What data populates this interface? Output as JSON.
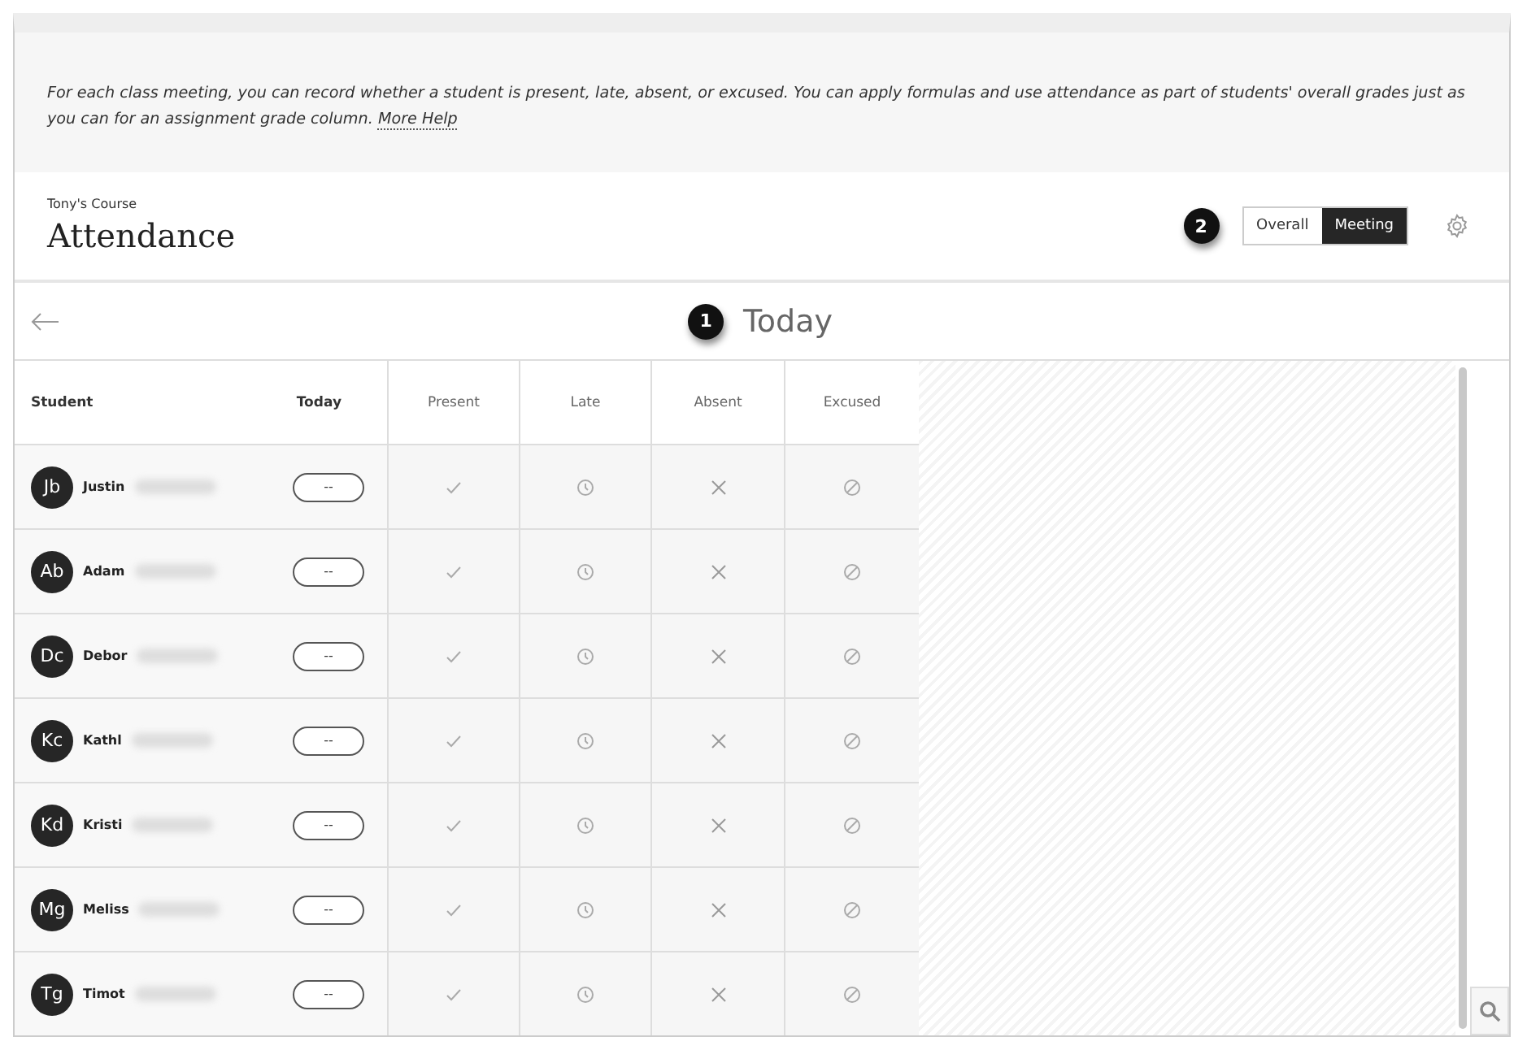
{
  "banner": {
    "text": "For each class meeting, you can record whether a student is present, late, absent, or excused. You can apply formulas and use attendance as part of students' overall grades just as you can for an assignment grade column.",
    "link": "More Help"
  },
  "header": {
    "course": "Tony's Course",
    "title": "Attendance",
    "callout": "2",
    "view_toggle": [
      {
        "label": "Overall",
        "selected": false
      },
      {
        "label": "Meeting",
        "selected": true
      }
    ]
  },
  "date_bar": {
    "callout": "1",
    "title": "Today"
  },
  "table": {
    "columns": [
      "Student",
      "Today",
      "Present",
      "Late",
      "Absent",
      "Excused"
    ],
    "rows": [
      {
        "initials": "Jb",
        "name": "Justin",
        "grade": "--"
      },
      {
        "initials": "Ab",
        "name": "Adam",
        "grade": "--"
      },
      {
        "initials": "Dc",
        "name": "Debor",
        "grade": "--"
      },
      {
        "initials": "Kc",
        "name": "Kathl",
        "grade": "--"
      },
      {
        "initials": "Kd",
        "name": "Kristi",
        "grade": "--"
      },
      {
        "initials": "Mg",
        "name": "Meliss",
        "grade": "--"
      },
      {
        "initials": "Tg",
        "name": "Timot",
        "grade": "--"
      }
    ]
  }
}
